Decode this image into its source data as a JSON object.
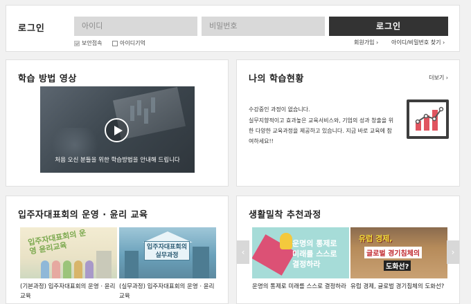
{
  "login": {
    "title": "로그인",
    "id_placeholder": "아이디",
    "pw_placeholder": "비밀번호",
    "button": "로그인",
    "secure_label": "보안접속",
    "remember_label": "아이디기억",
    "join_link": "회원가입 ›",
    "find_link": "아이디/비밀번호 찾기 ›"
  },
  "video_panel": {
    "title": "학습 방법 영상",
    "caption": "처음 오신 분들을 위한 학습방법을 안내해 드립니다"
  },
  "my_study": {
    "title": "나의 학습현황",
    "more": "더보기 ›",
    "no_course": "수강중인 과정이 없습니다.",
    "description": "실무지향적이고 효과높은 교육서비스와, 기업의 성과 창출을 위한 다양한 교육과정을 제공하고 있습니다. 지금 바로 교육에 참여하세요!!"
  },
  "ethics": {
    "title": "입주자대표회의 운영 · 윤리 교육",
    "items": [
      {
        "caption": "(기본과정) 입주자대표회의 운영 · 윤리교육",
        "thumb_text": "입주자대표회의 운영 윤리교육"
      },
      {
        "caption": "(실무과정) 입주자대표회의 운영 · 윤리교육",
        "thumb_text": "입주자대표회의 실무과정"
      }
    ]
  },
  "recommend": {
    "title": "생활밀착 추천과정",
    "items": [
      {
        "caption": "운명의 통제로 미래를 스스로 결정하라",
        "thumb_text": "운명의 통제로 미래를 스스로 결정하라"
      },
      {
        "caption": "유럽 경제, 글로벌 경기침체의 도화선?",
        "thumb_line1": "유럽 경제,",
        "thumb_line2": "글로벌 경기침체의",
        "thumb_line3": "도화선?"
      }
    ],
    "prev": "‹",
    "next": "›"
  },
  "colors": {
    "dark_button": "#333333",
    "accent_red": "#e0545f",
    "panel_bg": "#ffffff",
    "page_bg": "#f1f1f1"
  }
}
